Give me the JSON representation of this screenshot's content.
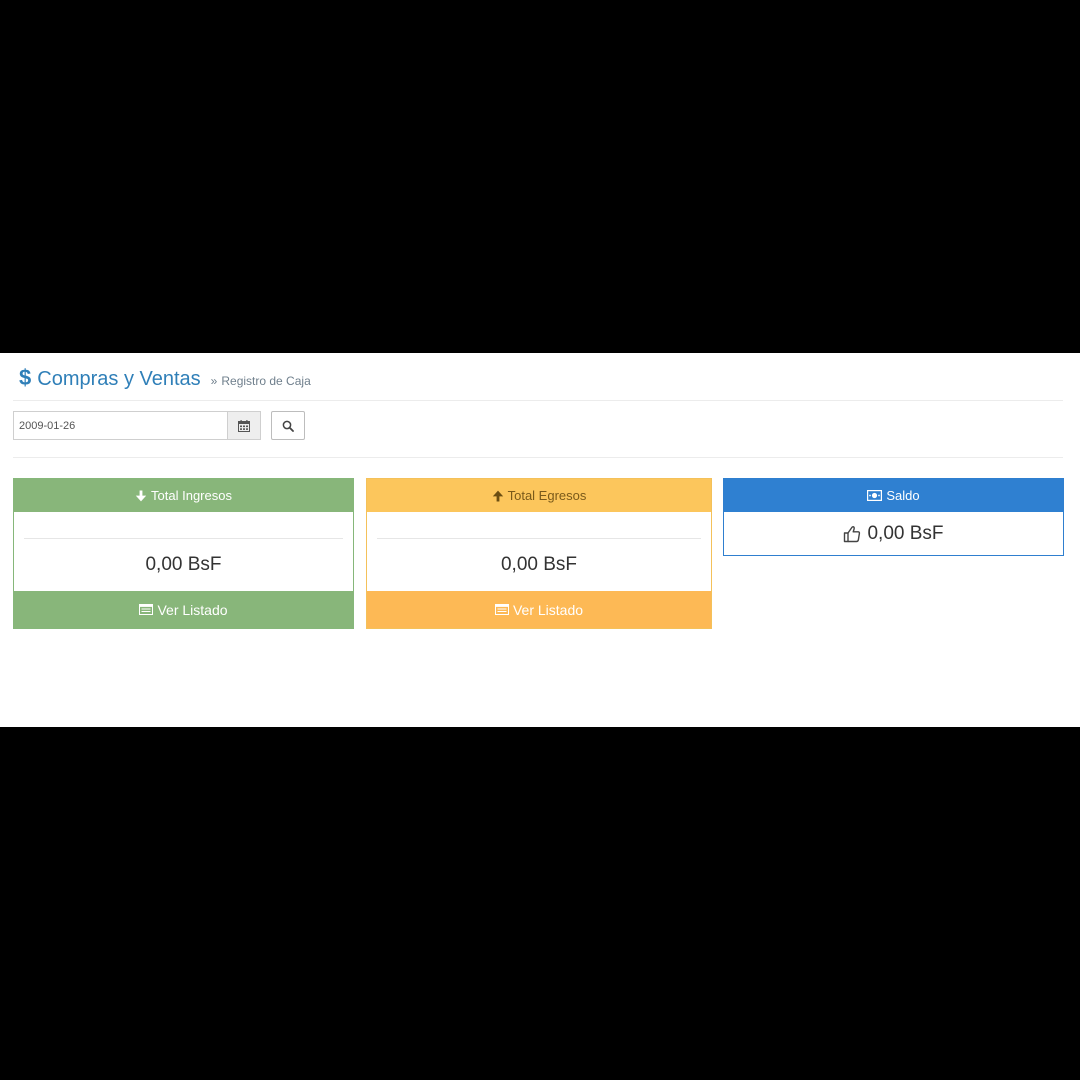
{
  "header": {
    "currency_icon": "dollar-sign-icon",
    "title": "Compras y Ventas",
    "breadcrumb_separator": "»",
    "breadcrumb": "Registro de Caja"
  },
  "filter": {
    "date_value": "2009-01-26",
    "calendar_icon": "calendar-icon",
    "search_icon": "search-icon"
  },
  "cards": {
    "ingresos": {
      "icon": "arrow-down-icon",
      "title": "Total Ingresos",
      "amount": "0,00 BsF",
      "footer_icon": "list-icon",
      "footer_label": "Ver Listado",
      "color": "#88b67a"
    },
    "egresos": {
      "icon": "arrow-up-icon",
      "title": "Total Egresos",
      "amount": "0,00 BsF",
      "footer_icon": "list-icon",
      "footer_label": "Ver Listado",
      "color": "#fcc65c"
    },
    "saldo": {
      "icon": "money-icon",
      "title": "Saldo",
      "amount_icon": "thumbs-up-icon",
      "amount": "0,00 BsF",
      "color": "#2f80d1"
    }
  }
}
